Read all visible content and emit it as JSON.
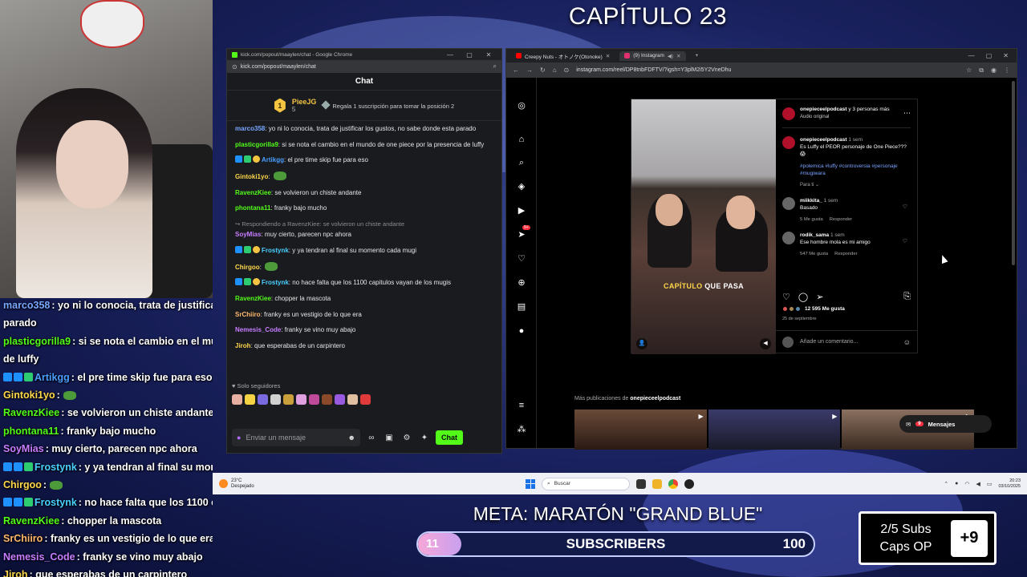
{
  "overlay": {
    "chapter_title": "CAPÍTULO 23",
    "meta_title": "META: MARATÓN \"GRAND BLUE\"",
    "meta_current": "11",
    "meta_label": "SUBSCRIBERS",
    "meta_goal": "100",
    "meta_progress": 0.11,
    "subs_line1": "2/5 Subs",
    "subs_line2": "Caps OP",
    "subs_plus": "+9"
  },
  "overlay_chat": [
    {
      "user": "marco358",
      "color": "#7aa7ff",
      "text": ": yo ni lo conocia, trata de justificar",
      "badges": 0
    },
    {
      "user": "",
      "color": "#fff",
      "text": "parado",
      "badges": 0
    },
    {
      "user": "plasticgorilla9",
      "color": "#53fc18",
      "text": ": si se nota el cambio en el mu",
      "badges": 0
    },
    {
      "user": "",
      "color": "#fff",
      "text": "de luffy",
      "badges": 0
    },
    {
      "user": "Artikgg",
      "color": "#4a9eff",
      "text": ": el pre time skip fue para eso",
      "badges": 3
    },
    {
      "user": "Gintoki1yo",
      "color": "#ffd84a",
      "text": ":",
      "badges": 0,
      "emote": true
    },
    {
      "user": "RavenzKiee",
      "color": "#53fc18",
      "text": ": se volvieron un chiste andante",
      "badges": 0
    },
    {
      "user": "phontana11",
      "color": "#53fc18",
      "text": ": franky bajo mucho",
      "badges": 0
    },
    {
      "user": "SoyMias",
      "color": "#c77dff",
      "text": ": muy cierto, parecen npc ahora",
      "badges": 0
    },
    {
      "user": "Frostynk",
      "color": "#4ad0ff",
      "text": ": y ya tendran al final su mom",
      "badges": 3
    },
    {
      "user": "Chirgoo",
      "color": "#ffd84a",
      "text": ":",
      "badges": 0,
      "emote": true
    },
    {
      "user": "Frostynk",
      "color": "#4ad0ff",
      "text": ": no hace falta que los 1100 c",
      "badges": 3
    },
    {
      "user": "RavenzKiee",
      "color": "#53fc18",
      "text": ": chopper la mascota",
      "badges": 0
    },
    {
      "user": "SrChiiro",
      "color": "#ffb86b",
      "text": ": franky es un vestigio de lo que era",
      "badges": 0
    },
    {
      "user": "Nemesis_Code",
      "color": "#c77dff",
      "text": ": franky se vino muy abajo",
      "badges": 0
    },
    {
      "user": "Jiroh",
      "color": "#ffd84a",
      "text": ": que esperabas de un carpintero",
      "badges": 0
    }
  ],
  "kick": {
    "window_title": "kick.com/popout/maaylen/chat - Google Chrome",
    "url": "kick.com/popout/maaylen/chat",
    "header": "Chat",
    "pinned_rank": "1",
    "pinned_user": "PieeJG",
    "pinned_count": "5",
    "pinned_text": "Regala 1 suscripción para tomar la posición 2",
    "follow_only": "Solo seguidores",
    "input_placeholder": "Enviar un mensaje",
    "send_label": "Chat",
    "messages": [
      {
        "user": "marco358",
        "color": "#7aa7ff",
        "text": ": yo ni lo conocia, trata de justificar los gustos, no sabe donde esta parado",
        "badges": 0
      },
      {
        "user": "plasticgorilla9",
        "color": "#53fc18",
        "text": ": si se nota el cambio en el mundo de one piece por la presencia de luffy",
        "badges": 0
      },
      {
        "user": "Artikgg",
        "color": "#4a9eff",
        "text": ": el pre time skip fue para eso",
        "badges": 3
      },
      {
        "user": "Gintoki1yo",
        "color": "#ffd84a",
        "text": ":",
        "badges": 0,
        "emote": true
      },
      {
        "user": "RavenzKiee",
        "color": "#53fc18",
        "text": ": se volvieron un chiste andante",
        "badges": 0
      },
      {
        "user": "phontana11",
        "color": "#53fc18",
        "text": ": franky bajo mucho",
        "badges": 0
      },
      {
        "reply": "Respondiendo a RavenzKiee: se volvieron un chiste andante",
        "user": "SoyMias",
        "color": "#c77dff",
        "text": ": muy cierto, parecen npc ahora",
        "badges": 0
      },
      {
        "user": "Frostynk",
        "color": "#4ad0ff",
        "text": ": y ya tendran al final su momento cada mugi",
        "badges": 3
      },
      {
        "user": "Chirgoo",
        "color": "#ffd84a",
        "text": ":",
        "badges": 0,
        "emote": true
      },
      {
        "user": "Frostynk",
        "color": "#4ad0ff",
        "text": ": no hace falta que los 1100 capitulos vayan de los mugis",
        "badges": 3
      },
      {
        "user": "RavenzKiee",
        "color": "#53fc18",
        "text": ": chopper la mascota",
        "badges": 0
      },
      {
        "user": "SrChiiro",
        "color": "#ffb86b",
        "text": ": franky es un vestigio de lo que era",
        "badges": 0
      },
      {
        "user": "Nemesis_Code",
        "color": "#c77dff",
        "text": ": franky se vino muy abajo",
        "badges": 0
      },
      {
        "user": "Jiroh",
        "color": "#ffd84a",
        "text": ": que esperabas de un carpintero",
        "badges": 0
      }
    ]
  },
  "instagram": {
    "tab1": "Creepy Nuts - オトノケ(Otonoke)",
    "tab2": "(9) Instagram",
    "url": "instagram.com/reel/DP8tnbFDFTV/?igsh=Y3plM2i5Y2VneDhu",
    "author": "onepieceelpodcast",
    "author_rest": " y 3 personas más",
    "audio": "Audio original",
    "caption_user": "onepieceelpodcast",
    "caption_time": "1 sem",
    "caption_text": "Es Luffy el PEOR personaje de One Piece??? 😱",
    "tags": "#polemica #luffy #controversia #personaje #mugiwara",
    "for_you": "Para ti ⌄",
    "comments": [
      {
        "user": "miikkita_",
        "time": "1 sem",
        "text": "Basado",
        "likes": "5 Me gusta",
        "reply": "Responder"
      },
      {
        "user": "rodik_sama",
        "time": "1 sem",
        "text": "Ese hombre mola es mi amigo",
        "likes": "547 Me gusta",
        "reply": "Responder"
      }
    ],
    "likes": "12 595 Me gusta",
    "date": "25 de septiembre",
    "add_comment": "Añade un comentario...",
    "video_caption_a": "CAPÍTULO",
    "video_caption_b": "QUE PASA",
    "more_posts_prefix": "Más publicaciones de ",
    "more_posts_user": "onepieceelpodcast",
    "messages_label": "Mensajes",
    "messages_badge": "9",
    "notif_badge": "9+"
  },
  "taskbar": {
    "temp": "23°C",
    "weather": "Despejado",
    "search": "Buscar",
    "time": "20:23",
    "date": "03/10/2025"
  }
}
